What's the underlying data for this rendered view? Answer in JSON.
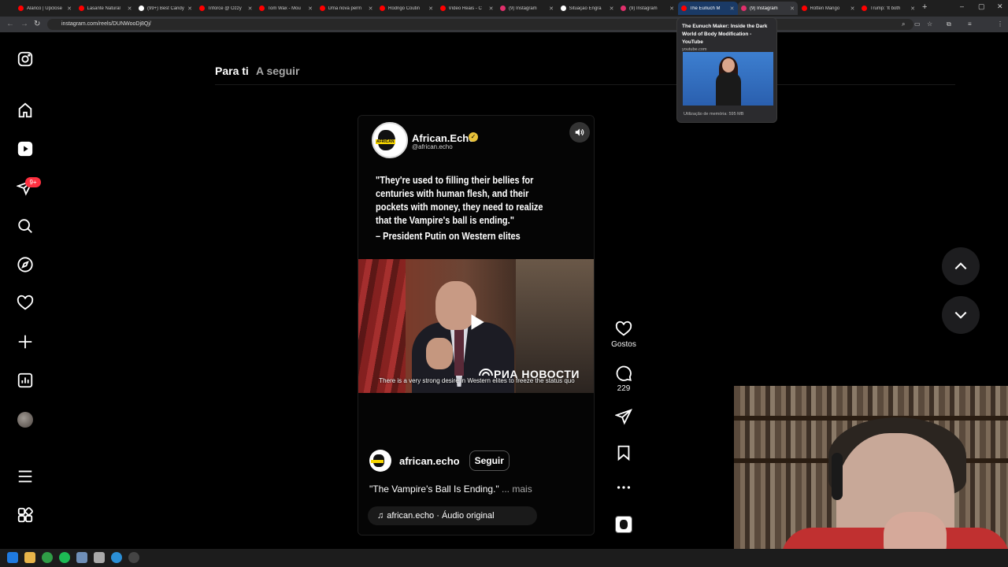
{
  "browser": {
    "tabs": [
      {
        "title": "Alarico | Upclose",
        "color": "#ff0000"
      },
      {
        "title": "Lasante Natural",
        "color": "#ff0000"
      },
      {
        "title": "(99+) Best Candy",
        "color": "#ffffff"
      },
      {
        "title": "Triforce @ Ozzy",
        "color": "#ff0000"
      },
      {
        "title": "Tom Wax - Mou",
        "color": "#ff0000"
      },
      {
        "title": "Uma nova perm",
        "color": "#ff0000"
      },
      {
        "title": "Rodrigo Coutin",
        "color": "#ff0000"
      },
      {
        "title": "Vídeo Reais - C",
        "color": "#ff0000"
      },
      {
        "title": "(9) Instagram",
        "color": "#e1306c"
      },
      {
        "title": "Situação Engra",
        "color": "#ffffff"
      },
      {
        "title": "(9) Instagram",
        "color": "#e1306c"
      },
      {
        "title": "The Eunuch M",
        "color": "#ff0000"
      },
      {
        "title": "(9) Instagram",
        "color": "#e1306c"
      },
      {
        "title": "Rotten Mango",
        "color": "#ff0000"
      },
      {
        "title": "Trump: 'It both",
        "color": "#ff0000"
      }
    ],
    "url": "instagram.com/reels/DUNWooDj8Qj/"
  },
  "hover_preview": {
    "title": "The Eunuch Maker: Inside the Dark World of Body Modification - YouTube",
    "host": "youtube.com",
    "memory": "Utilização de memória: 595 MB"
  },
  "instagram": {
    "feed_tabs": {
      "for_you": "Para ti",
      "following": "A seguir"
    },
    "notification_count": "9+",
    "reel": {
      "account_display": "African.Echo",
      "account_handle": "@african.echo",
      "avatar_label": "AFRICAN",
      "quote": "\"They're used to filling their bellies for centuries with human flesh, and their pockets with money, they need to realize that the Vampire's ball is ending.\"",
      "attribution": "– President Putin on Western elites",
      "video_watermark": "РИА НОВОСТИ",
      "video_subtitle": "There is a very strong desire in Western elites to freeze the status quo",
      "author": "african.echo",
      "follow_label": "Seguir",
      "caption": "\"The Vampire's Ball Is Ending.\"",
      "caption_more": "... mais",
      "audio": "african.echo · Áudio original"
    },
    "actions": {
      "likes_label": "Gostos",
      "comments_count": "229"
    }
  },
  "colors": {
    "background": "#000000",
    "badge": "#ff3040",
    "verified": "#e8c23a"
  }
}
